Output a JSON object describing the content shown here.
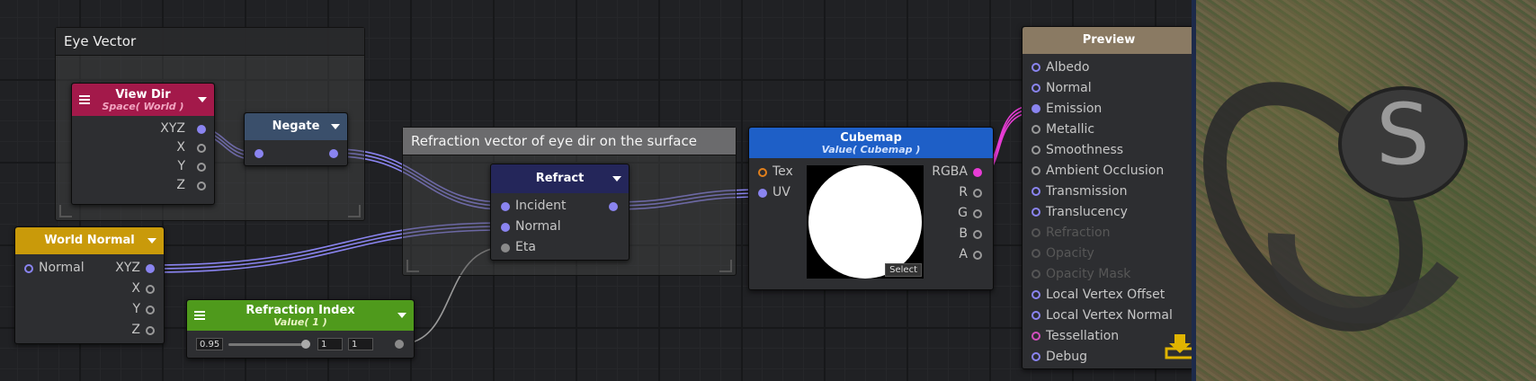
{
  "groups": {
    "eye_vector": {
      "title": "Eye Vector"
    },
    "refraction": {
      "title": "Refraction vector of eye dir on the surface"
    }
  },
  "nodes": {
    "view_dir": {
      "title": "View Dir",
      "subtitle": "Space( World )",
      "outputs": [
        "XYZ",
        "X",
        "Y",
        "Z"
      ]
    },
    "negate": {
      "title": "Negate"
    },
    "world_normal": {
      "title": "World Normal",
      "input": "Normal",
      "outputs": [
        "XYZ",
        "X",
        "Y",
        "Z"
      ]
    },
    "refract": {
      "title": "Refract",
      "inputs": [
        "Incident",
        "Normal",
        "Eta"
      ]
    },
    "refraction_index": {
      "title": "Refraction Index",
      "subtitle": "Value( 1 )",
      "value": "0.95",
      "min": "1",
      "max": "1"
    },
    "cubemap": {
      "title": "Cubemap",
      "subtitle": "Value( Cubemap )",
      "inputs": [
        "Tex",
        "UV"
      ],
      "outputs": [
        "RGBA",
        "R",
        "G",
        "B",
        "A"
      ],
      "select_label": "Select"
    },
    "preview": {
      "title": "Preview",
      "inputs": [
        {
          "label": "Albedo",
          "enabled": true
        },
        {
          "label": "Normal",
          "enabled": true
        },
        {
          "label": "Emission",
          "enabled": true
        },
        {
          "label": "Metallic",
          "enabled": true
        },
        {
          "label": "Smoothness",
          "enabled": true
        },
        {
          "label": "Ambient Occlusion",
          "enabled": true
        },
        {
          "label": "Transmission",
          "enabled": true
        },
        {
          "label": "Translucency",
          "enabled": true
        },
        {
          "label": "Refraction",
          "enabled": false
        },
        {
          "label": "Opacity",
          "enabled": false
        },
        {
          "label": "Opacity Mask",
          "enabled": false
        },
        {
          "label": "Local Vertex Offset",
          "enabled": true
        },
        {
          "label": "Local Vertex Normal",
          "enabled": true
        },
        {
          "label": "Tessellation",
          "enabled": true
        },
        {
          "label": "Debug",
          "enabled": true
        }
      ]
    }
  },
  "viewport": {
    "logo_letter": "S"
  },
  "colors": {
    "view_dir_header": "#a3194a",
    "negate_header": "#3a4f6b",
    "world_normal_header": "#c99a0a",
    "refract_header": "#24265a",
    "refraction_index_header": "#4f9a1c",
    "cubemap_header": "#1e5fc7",
    "preview_header": "#8a7a63",
    "wire_vector": "#8a84f0",
    "wire_color": "#e83cd6",
    "wire_float": "#9a9a9a"
  }
}
